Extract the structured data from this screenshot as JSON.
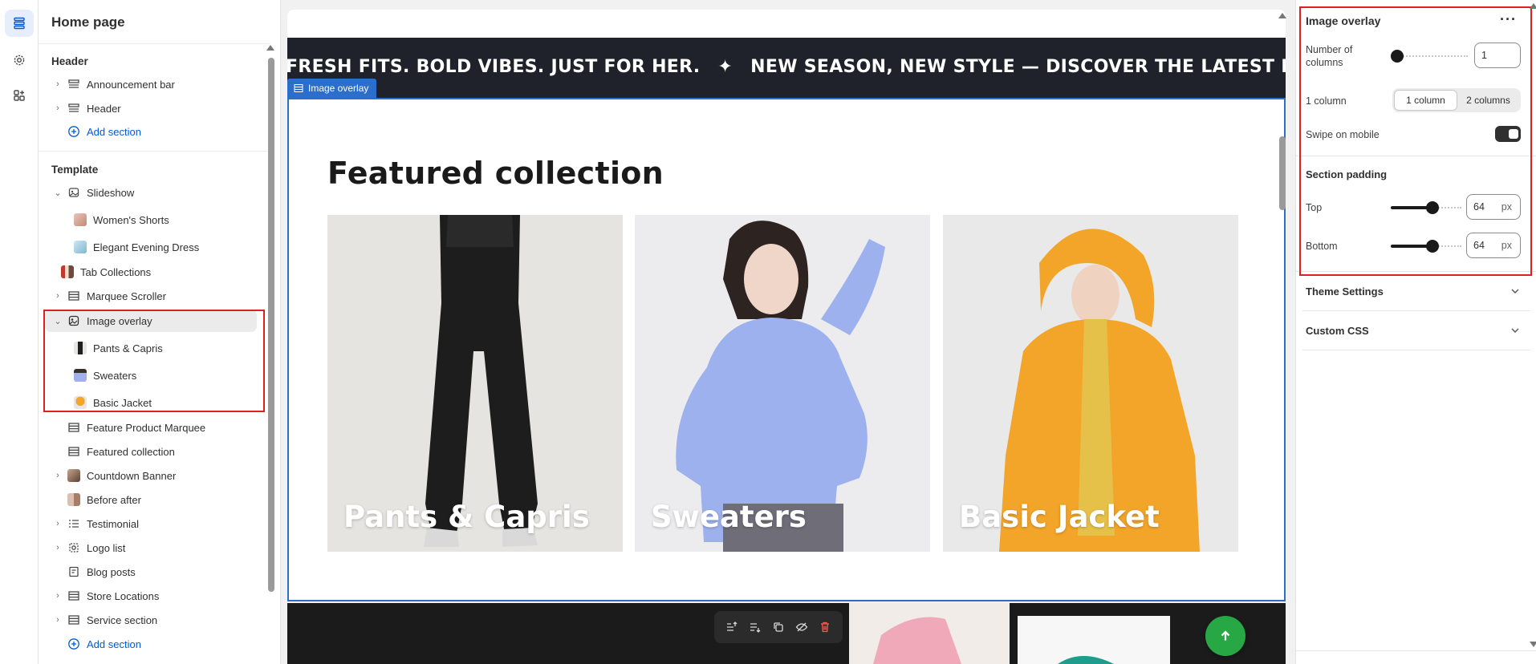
{
  "sidebar": {
    "title": "Home page",
    "header_group": "Header",
    "header_items": [
      {
        "label": "Announcement bar"
      },
      {
        "label": "Header"
      }
    ],
    "add_section_1": "Add section",
    "template_group": "Template",
    "slideshow": {
      "label": "Slideshow",
      "children": [
        "Women's Shorts",
        "Elegant Evening Dress"
      ]
    },
    "tab_collections": "Tab Collections",
    "marquee_scroller": "Marquee Scroller",
    "image_overlay": {
      "label": "Image overlay",
      "children": [
        "Pants & Capris",
        "Sweaters",
        "Basic Jacket"
      ]
    },
    "rest": [
      {
        "label": "Feature Product Marquee",
        "expandable": false
      },
      {
        "label": "Featured collection",
        "expandable": false
      },
      {
        "label": "Countdown Banner",
        "expandable": true
      },
      {
        "label": "Before after",
        "expandable": false
      },
      {
        "label": "Testimonial",
        "expandable": true
      },
      {
        "label": "Logo list",
        "expandable": true
      },
      {
        "label": "Blog posts",
        "expandable": false
      },
      {
        "label": "Store Locations",
        "expandable": true
      },
      {
        "label": "Service section",
        "expandable": true
      }
    ],
    "add_section_2": "Add section"
  },
  "preview": {
    "marquee_items": [
      "FRESH FITS. BOLD VIBES. JUST FOR HER.",
      "NEW SEASON, NEW STYLE — DISCOVER THE LATEST IN WOMEN'S FASHION"
    ],
    "marquee_separator": "✦",
    "selected_tag": "Image overlay",
    "section_title": "Featured collection",
    "cards": [
      {
        "label": "Pants & Capris"
      },
      {
        "label": "Sweaters"
      },
      {
        "label": "Basic Jacket"
      }
    ]
  },
  "settings": {
    "title": "Image overlay",
    "more": "···",
    "columns_label": "Number of columns",
    "columns_value": "1",
    "columns_slider_fraction": 0,
    "mobile_columns_label": "1 column",
    "mobile_options": [
      "1 column",
      "2 columns"
    ],
    "mobile_selected": "1 column",
    "swipe_label": "Swipe on mobile",
    "swipe_on": true,
    "padding_heading": "Section padding",
    "top_label": "Top",
    "top_value": "64",
    "bottom_label": "Bottom",
    "bottom_value": "64",
    "unit": "px",
    "theme_settings": "Theme Settings",
    "custom_css": "Custom CSS"
  },
  "colors": {
    "accent": "#005bd3",
    "selection": "#2c6ecb",
    "highlight": "#e02020",
    "fab": "#27a844"
  }
}
